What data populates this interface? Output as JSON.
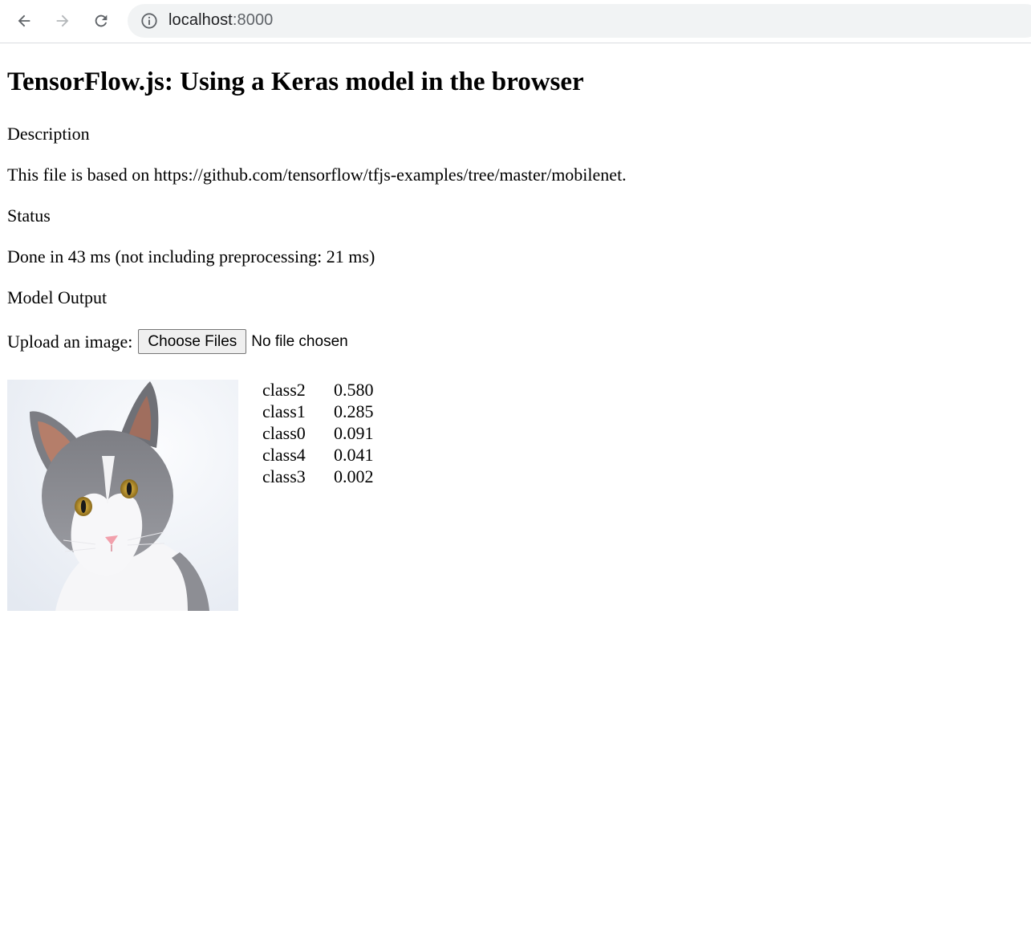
{
  "browser": {
    "url_host": "localhost",
    "url_port": ":8000"
  },
  "page": {
    "title": "TensorFlow.js: Using a Keras model in the browser",
    "description_heading": "Description",
    "description_text": "This file is based on https://github.com/tensorflow/tfjs-examples/tree/master/mobilenet.",
    "status_heading": "Status",
    "status_text": "Done in 43 ms (not including preprocessing: 21 ms)",
    "model_output_heading": "Model Output",
    "upload_label": "Upload an image:",
    "file_button_label": "Choose Files",
    "file_status": "No file chosen"
  },
  "predictions": [
    {
      "class": "class2",
      "prob": "0.580"
    },
    {
      "class": "class1",
      "prob": "0.285"
    },
    {
      "class": "class0",
      "prob": "0.091"
    },
    {
      "class": "class4",
      "prob": "0.041"
    },
    {
      "class": "class3",
      "prob": "0.002"
    }
  ]
}
